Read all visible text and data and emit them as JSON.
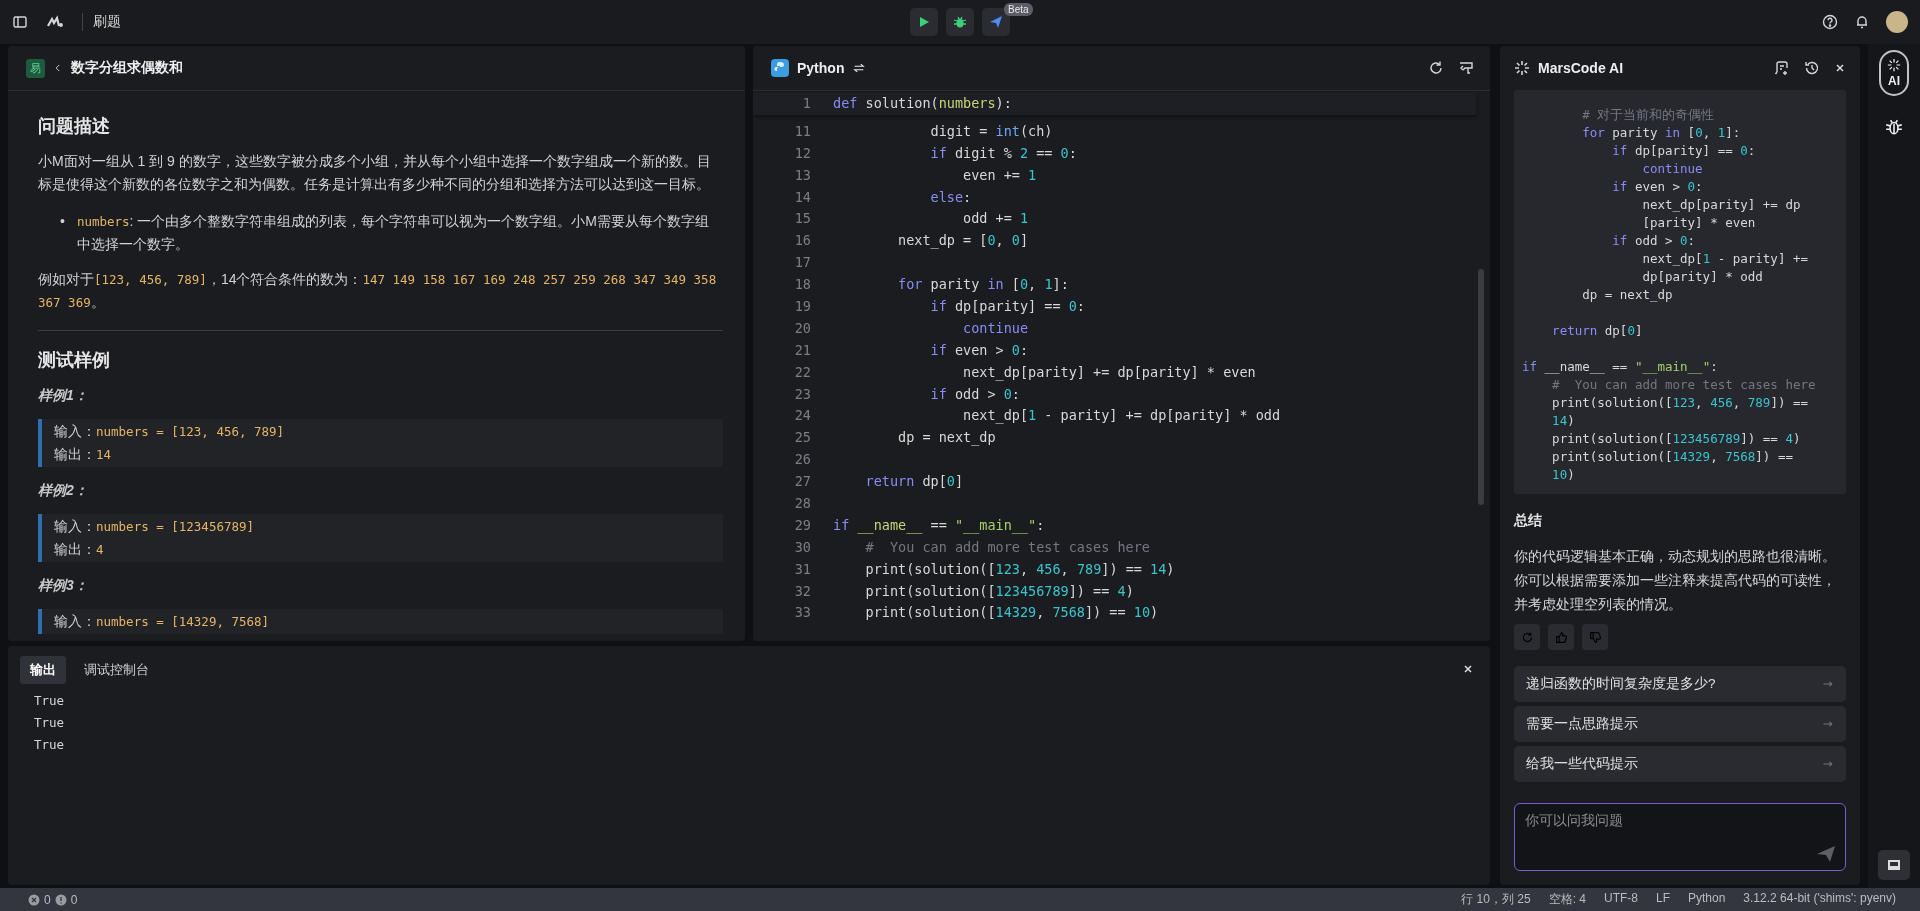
{
  "topbar": {
    "title": "刷题",
    "submit_badge": "Beta"
  },
  "problem": {
    "difficulty": "易",
    "title": "数字分组求偶数和",
    "description_heading": "问题描述",
    "paragraphs": [
      [
        {
          "kind": "text",
          "text": "小M面对一组从 1 到 9 的数字，这些数字被分成多个小组，并从每个小组中选择一个数字组成一个新的数。目标是使得这个新数的各位数字之和为偶数。任务是计算出有多少种不同的分组和选择方法可以达到这一目标。"
        }
      ]
    ],
    "bullets": [
      {
        "marker": "•",
        "segments": [
          {
            "kind": "code",
            "text": "numbers"
          },
          {
            "kind": "text",
            "text": ": 一个由多个整数字符串组成的列表，每个字符串可以视为一个数字组。小M需要从每个数字组中选择一个数字。"
          }
        ]
      }
    ],
    "example": [
      {
        "kind": "text",
        "text": "例如对于"
      },
      {
        "kind": "code",
        "text": "[123, 456, 789]"
      },
      {
        "kind": "text",
        "text": "，14个符合条件的数为："
      },
      {
        "kind": "code",
        "text": "147 149 158 167 169 248 257 259 268 347 349 358 367 369"
      },
      {
        "kind": "text",
        "text": "。"
      }
    ],
    "samples_heading": "测试样例",
    "samples": [
      {
        "label": "样例1：",
        "input_label": "输入：",
        "input": "numbers = [123, 456, 789]",
        "output_label": "输出：",
        "output": "14"
      },
      {
        "label": "样例2：",
        "input_label": "输入：",
        "input": "numbers = [123456789]",
        "output_label": "输出：",
        "output": "4"
      },
      {
        "label": "样例3：",
        "input_label": "输入：",
        "input": "numbers = [14329, 7568]"
      }
    ]
  },
  "editor": {
    "language": "Python",
    "sticky": {
      "n": "1",
      "kind": "code",
      "tokens": [
        {
          "kind": "kw",
          "text": "def"
        },
        {
          "kind": "p",
          "text": " solution("
        },
        {
          "kind": "var",
          "text": "numbers"
        },
        {
          "kind": "p",
          "text": "):"
        }
      ]
    },
    "lines": [
      {
        "n": "11",
        "kind": "code",
        "tokens": [
          {
            "kind": "p",
            "text": "            digit = "
          },
          {
            "kind": "fn",
            "text": "int"
          },
          {
            "kind": "p",
            "text": "(ch)"
          }
        ]
      },
      {
        "n": "12",
        "kind": "code",
        "tokens": [
          {
            "kind": "kw",
            "text": "            if"
          },
          {
            "kind": "p",
            "text": " digit % "
          },
          {
            "kind": "num",
            "text": "2"
          },
          {
            "kind": "p",
            "text": " == "
          },
          {
            "kind": "num",
            "text": "0"
          },
          {
            "kind": "p",
            "text": ":"
          }
        ]
      },
      {
        "n": "13",
        "kind": "code",
        "tokens": [
          {
            "kind": "p",
            "text": "                even += "
          },
          {
            "kind": "num",
            "text": "1"
          }
        ]
      },
      {
        "n": "14",
        "kind": "code",
        "tokens": [
          {
            "kind": "kw",
            "text": "            else"
          },
          {
            "kind": "p",
            "text": ":"
          }
        ]
      },
      {
        "n": "15",
        "kind": "code",
        "tokens": [
          {
            "kind": "p",
            "text": "                odd += "
          },
          {
            "kind": "num",
            "text": "1"
          }
        ]
      },
      {
        "n": "16",
        "kind": "code",
        "tokens": [
          {
            "kind": "p",
            "text": "        next_dp = ["
          },
          {
            "kind": "num",
            "text": "0"
          },
          {
            "kind": "p",
            "text": ", "
          },
          {
            "kind": "num",
            "text": "0"
          },
          {
            "kind": "p",
            "text": "]"
          }
        ]
      },
      {
        "n": "17",
        "kind": "blank"
      },
      {
        "n": "18",
        "kind": "code",
        "tokens": [
          {
            "kind": "kw",
            "text": "        for"
          },
          {
            "kind": "p",
            "text": " parity "
          },
          {
            "kind": "kw",
            "text": "in"
          },
          {
            "kind": "p",
            "text": " ["
          },
          {
            "kind": "num",
            "text": "0"
          },
          {
            "kind": "p",
            "text": ", "
          },
          {
            "kind": "num",
            "text": "1"
          },
          {
            "kind": "p",
            "text": "]:"
          }
        ]
      },
      {
        "n": "19",
        "kind": "code",
        "tokens": [
          {
            "kind": "kw",
            "text": "            if"
          },
          {
            "kind": "p",
            "text": " dp[parity] == "
          },
          {
            "kind": "num",
            "text": "0"
          },
          {
            "kind": "p",
            "text": ":"
          }
        ]
      },
      {
        "n": "20",
        "kind": "code",
        "tokens": [
          {
            "kind": "kw",
            "text": "                continue"
          }
        ]
      },
      {
        "n": "21",
        "kind": "code",
        "tokens": [
          {
            "kind": "kw",
            "text": "            if"
          },
          {
            "kind": "p",
            "text": " even > "
          },
          {
            "kind": "num",
            "text": "0"
          },
          {
            "kind": "p",
            "text": ":"
          }
        ]
      },
      {
        "n": "22",
        "kind": "code",
        "tokens": [
          {
            "kind": "p",
            "text": "                next_dp[parity] += dp[parity] * even"
          }
        ]
      },
      {
        "n": "23",
        "kind": "code",
        "tokens": [
          {
            "kind": "kw",
            "text": "            if"
          },
          {
            "kind": "p",
            "text": " odd > "
          },
          {
            "kind": "num",
            "text": "0"
          },
          {
            "kind": "p",
            "text": ":"
          }
        ]
      },
      {
        "n": "24",
        "kind": "code",
        "tokens": [
          {
            "kind": "p",
            "text": "                next_dp["
          },
          {
            "kind": "num",
            "text": "1"
          },
          {
            "kind": "p",
            "text": " - parity] += dp[parity] * odd"
          }
        ]
      },
      {
        "n": "25",
        "kind": "code",
        "tokens": [
          {
            "kind": "p",
            "text": "        dp = next_dp"
          }
        ]
      },
      {
        "n": "26",
        "kind": "blank"
      },
      {
        "n": "27",
        "kind": "code",
        "tokens": [
          {
            "kind": "kw",
            "text": "    return"
          },
          {
            "kind": "p",
            "text": " dp["
          },
          {
            "kind": "num",
            "text": "0"
          },
          {
            "kind": "p",
            "text": "]"
          }
        ]
      },
      {
        "n": "28",
        "kind": "blank"
      },
      {
        "n": "29",
        "kind": "code",
        "tokens": [
          {
            "kind": "kw",
            "text": "if"
          },
          {
            "kind": "var",
            "text": " __name__"
          },
          {
            "kind": "p",
            "text": " == "
          },
          {
            "kind": "str",
            "text": "\"__main__\""
          },
          {
            "kind": "p",
            "text": ":"
          }
        ]
      },
      {
        "n": "30",
        "kind": "code",
        "tokens": [
          {
            "kind": "cm",
            "text": "    #  You can add more test cases here"
          }
        ]
      },
      {
        "n": "31",
        "kind": "code",
        "tokens": [
          {
            "kind": "p",
            "text": "    print(solution(["
          },
          {
            "kind": "num",
            "text": "123"
          },
          {
            "kind": "p",
            "text": ", "
          },
          {
            "kind": "num",
            "text": "456"
          },
          {
            "kind": "p",
            "text": ", "
          },
          {
            "kind": "num",
            "text": "789"
          },
          {
            "kind": "p",
            "text": "]) == "
          },
          {
            "kind": "num",
            "text": "14"
          },
          {
            "kind": "p",
            "text": ")"
          }
        ]
      },
      {
        "n": "32",
        "kind": "code",
        "tokens": [
          {
            "kind": "p",
            "text": "    print(solution(["
          },
          {
            "kind": "num",
            "text": "123456789"
          },
          {
            "kind": "p",
            "text": "]) == "
          },
          {
            "kind": "num",
            "text": "4"
          },
          {
            "kind": "p",
            "text": ")"
          }
        ]
      },
      {
        "n": "33",
        "kind": "code",
        "tokens": [
          {
            "kind": "p",
            "text": "    print(solution(["
          },
          {
            "kind": "num",
            "text": "14329"
          },
          {
            "kind": "p",
            "text": ", "
          },
          {
            "kind": "num",
            "text": "7568"
          },
          {
            "kind": "p",
            "text": "]) == "
          },
          {
            "kind": "num",
            "text": "10"
          },
          {
            "kind": "p",
            "text": ")"
          }
        ]
      }
    ]
  },
  "output": {
    "tabs": [
      {
        "label": "输出",
        "selected": true
      },
      {
        "label": "调试控制台",
        "selected": false
      }
    ],
    "lines": [
      "True",
      "True",
      "True"
    ]
  },
  "assistant": {
    "title": "MarsCode AI",
    "code_lines": [
      {
        "kind": "code",
        "tokens": [
          {
            "kind": "cm",
            "text": "        # 对于当前和的奇偶性"
          }
        ]
      },
      {
        "kind": "code",
        "tokens": [
          {
            "kind": "kw",
            "text": "        for"
          },
          {
            "kind": "p",
            "text": " parity "
          },
          {
            "kind": "kw",
            "text": "in"
          },
          {
            "kind": "p",
            "text": " ["
          },
          {
            "kind": "num",
            "text": "0"
          },
          {
            "kind": "p",
            "text": ", "
          },
          {
            "kind": "num",
            "text": "1"
          },
          {
            "kind": "p",
            "text": "]:"
          }
        ]
      },
      {
        "kind": "code",
        "tokens": [
          {
            "kind": "kw",
            "text": "            if"
          },
          {
            "kind": "p",
            "text": " dp[parity] == "
          },
          {
            "kind": "num",
            "text": "0"
          },
          {
            "kind": "p",
            "text": ":"
          }
        ]
      },
      {
        "kind": "code",
        "tokens": [
          {
            "kind": "kw",
            "text": "                continue"
          }
        ]
      },
      {
        "kind": "code",
        "tokens": [
          {
            "kind": "kw",
            "text": "            if"
          },
          {
            "kind": "p",
            "text": " even > "
          },
          {
            "kind": "num",
            "text": "0"
          },
          {
            "kind": "p",
            "text": ":"
          }
        ]
      },
      {
        "kind": "code",
        "tokens": [
          {
            "kind": "p",
            "text": "                next_dp[parity] += dp"
          }
        ]
      },
      {
        "kind": "code",
        "tokens": [
          {
            "kind": "p",
            "text": "                [parity] * even"
          }
        ]
      },
      {
        "kind": "code",
        "tokens": [
          {
            "kind": "kw",
            "text": "            if"
          },
          {
            "kind": "p",
            "text": " odd > "
          },
          {
            "kind": "num",
            "text": "0"
          },
          {
            "kind": "p",
            "text": ":"
          }
        ]
      },
      {
        "kind": "code",
        "tokens": [
          {
            "kind": "p",
            "text": "                next_dp["
          },
          {
            "kind": "num",
            "text": "1"
          },
          {
            "kind": "p",
            "text": " - parity] +="
          }
        ]
      },
      {
        "kind": "code",
        "tokens": [
          {
            "kind": "p",
            "text": "                dp[parity] * odd"
          }
        ]
      },
      {
        "kind": "code",
        "tokens": [
          {
            "kind": "p",
            "text": "        dp = next_dp"
          }
        ]
      },
      {
        "kind": "blank"
      },
      {
        "kind": "code",
        "tokens": [
          {
            "kind": "kw",
            "text": "    return"
          },
          {
            "kind": "p",
            "text": " dp["
          },
          {
            "kind": "num",
            "text": "0"
          },
          {
            "kind": "p",
            "text": "]"
          }
        ]
      },
      {
        "kind": "blank"
      },
      {
        "kind": "code",
        "tokens": [
          {
            "kind": "kw",
            "text": "if"
          },
          {
            "kind": "p",
            "text": " __name__ == "
          },
          {
            "kind": "str",
            "text": "\"__main__\""
          },
          {
            "kind": "p",
            "text": ":"
          }
        ]
      },
      {
        "kind": "code",
        "tokens": [
          {
            "kind": "cm",
            "text": "    #  You can add more test cases here"
          }
        ]
      },
      {
        "kind": "code",
        "tokens": [
          {
            "kind": "p",
            "text": "    print(solution(["
          },
          {
            "kind": "num",
            "text": "123"
          },
          {
            "kind": "p",
            "text": ", "
          },
          {
            "kind": "num",
            "text": "456"
          },
          {
            "kind": "p",
            "text": ", "
          },
          {
            "kind": "num",
            "text": "789"
          },
          {
            "kind": "p",
            "text": "]) =="
          }
        ]
      },
      {
        "kind": "code",
        "tokens": [
          {
            "kind": "num",
            "text": "    14"
          },
          {
            "kind": "p",
            "text": ")"
          }
        ]
      },
      {
        "kind": "code",
        "tokens": [
          {
            "kind": "p",
            "text": "    print(solution(["
          },
          {
            "kind": "num",
            "text": "123456789"
          },
          {
            "kind": "p",
            "text": "]) == "
          },
          {
            "kind": "num",
            "text": "4"
          },
          {
            "kind": "p",
            "text": ")"
          }
        ]
      },
      {
        "kind": "code",
        "tokens": [
          {
            "kind": "p",
            "text": "    print(solution(["
          },
          {
            "kind": "num",
            "text": "14329"
          },
          {
            "kind": "p",
            "text": ", "
          },
          {
            "kind": "num",
            "text": "7568"
          },
          {
            "kind": "p",
            "text": "]) =="
          }
        ]
      },
      {
        "kind": "code",
        "tokens": [
          {
            "kind": "num",
            "text": "    10"
          },
          {
            "kind": "p",
            "text": ")"
          }
        ]
      }
    ],
    "summary_heading": "总结",
    "summary_lines": [
      "你的代码逻辑基本正确，动态规划的思路也很清晰。",
      "你可以根据需要添加一些注释来提高代码的可读性，",
      "并考虑处理空列表的情况。"
    ],
    "suggestions": [
      "递归函数的时间复杂度是多少?",
      "需要一点思路提示",
      "给我一些代码提示"
    ],
    "input": {
      "placeholder": "你可以问我问题"
    }
  },
  "rail": [
    {
      "kind": "ai",
      "label": "AI",
      "selected": true
    },
    {
      "kind": "bug",
      "selected": false
    }
  ],
  "status_bar": {
    "errors": "0",
    "warnings": "0",
    "items": [
      "行 10，列 25",
      "空格: 4",
      "UTF-8",
      "LF",
      "Python",
      "3.12.2 64-bit ('shims': pyenv)"
    ]
  }
}
